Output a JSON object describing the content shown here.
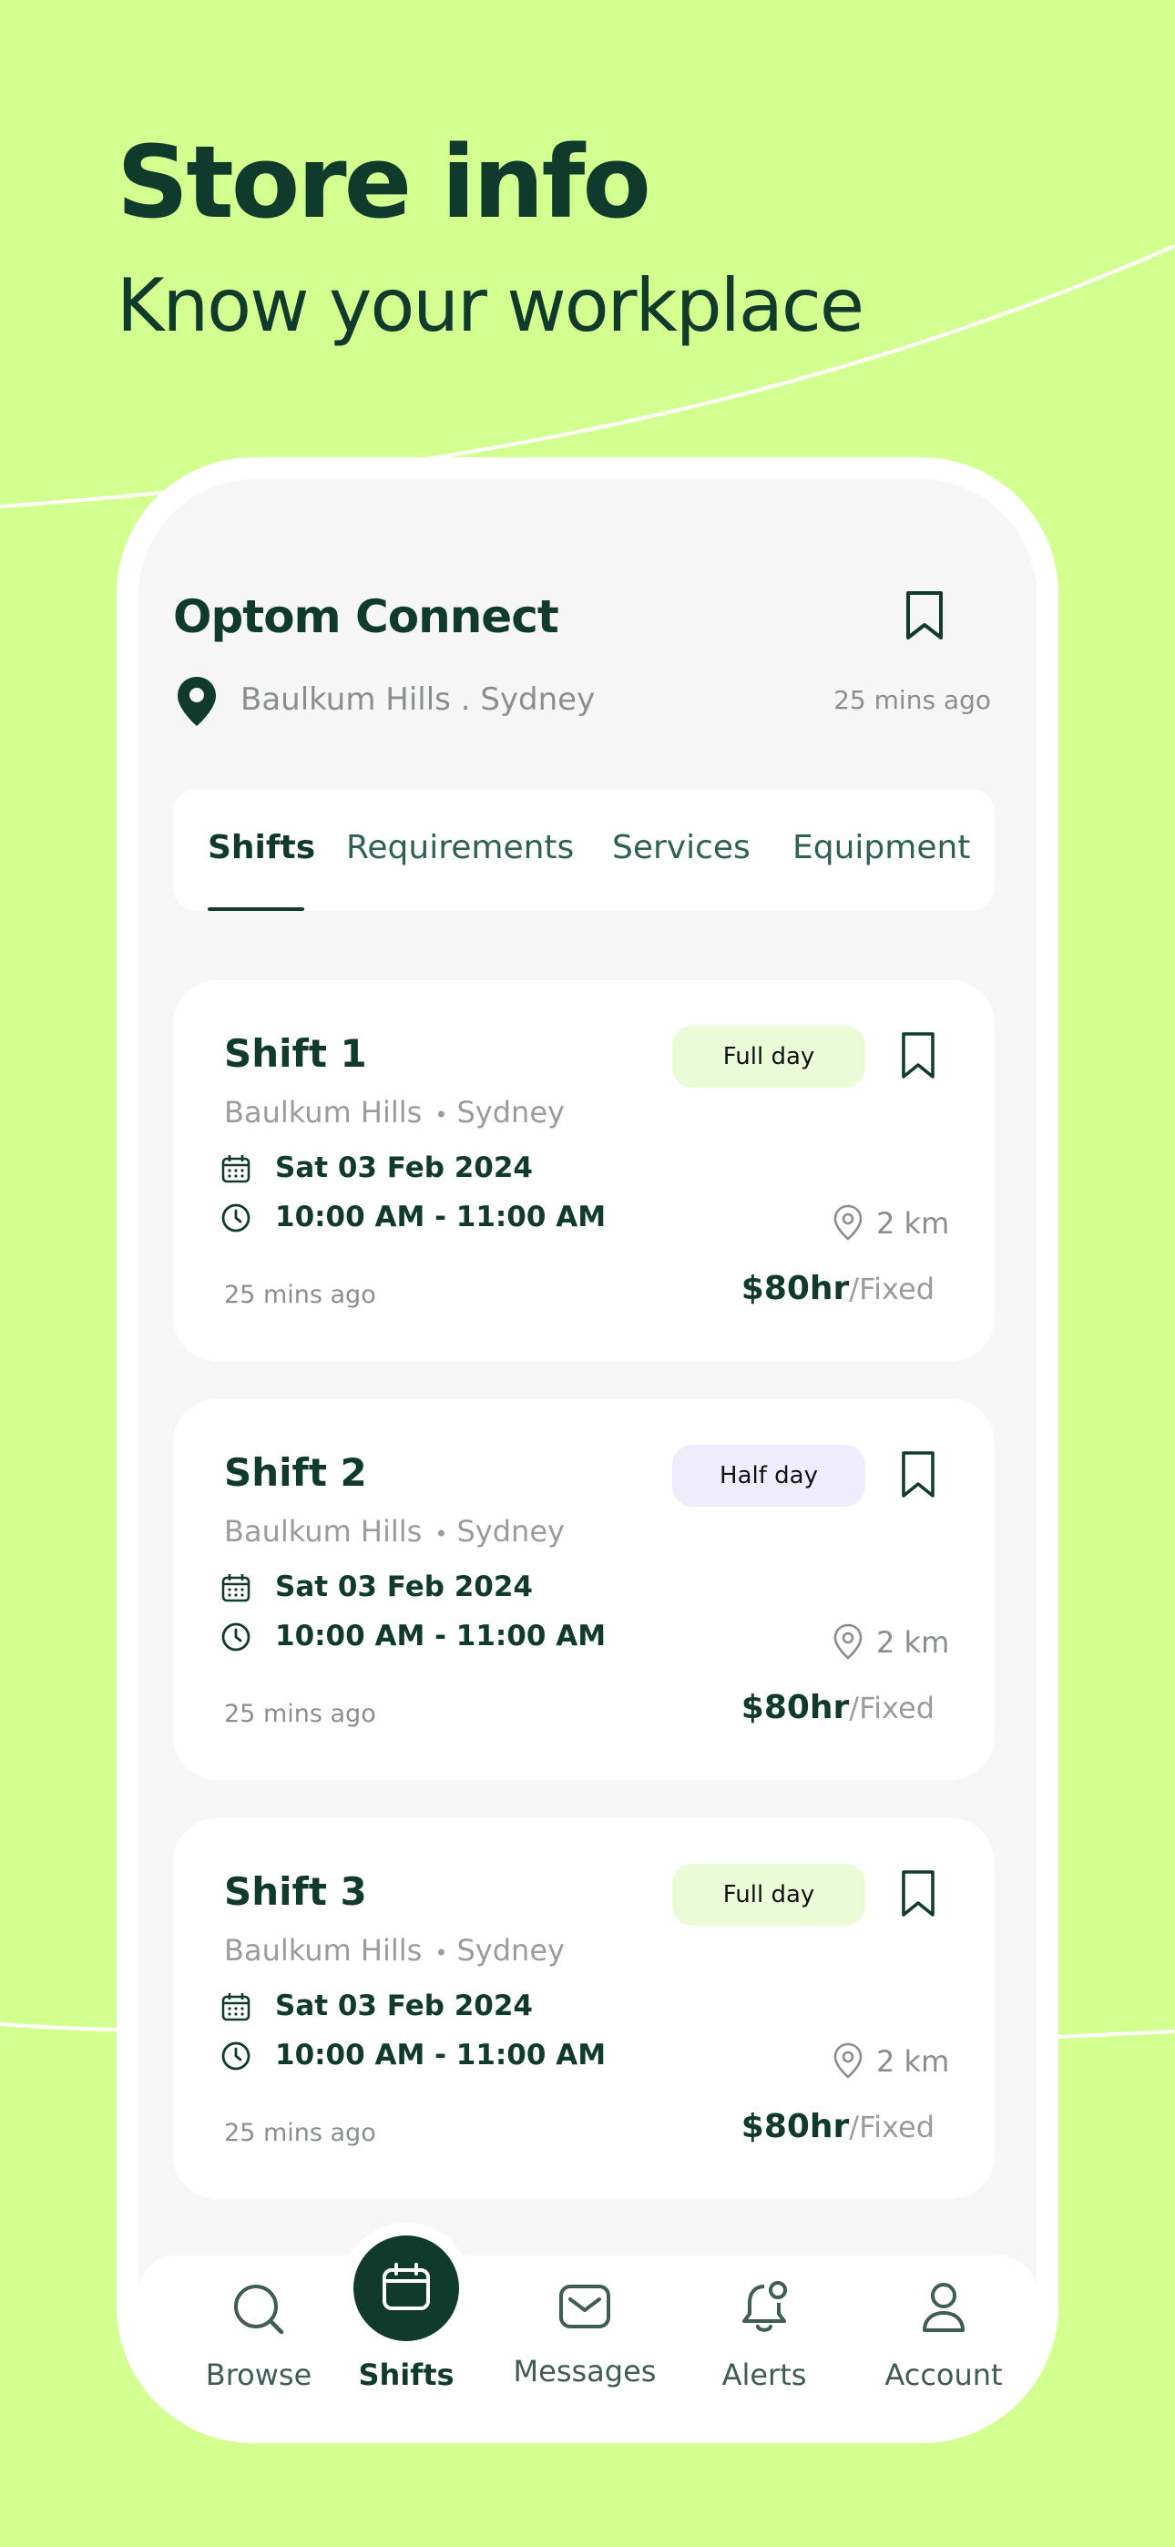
{
  "hero": {
    "title": "Store info",
    "subtitle": "Know your workplace"
  },
  "store": {
    "name": "Optom Connect",
    "location": "Baulkum Hills . Sydney",
    "posted": "25 mins ago"
  },
  "tabs": [
    {
      "label": "Shifts",
      "active": true
    },
    {
      "label": "Requirements",
      "active": false
    },
    {
      "label": "Services",
      "active": false
    },
    {
      "label": "Equipment",
      "active": false
    }
  ],
  "shifts": [
    {
      "title": "Shift 1",
      "badge": "Full day",
      "suburb": "Baulkum Hills",
      "city": "Sydney",
      "date": "Sat 03 Feb 2024",
      "time": "10:00 AM - 11:00 AM",
      "distance": "2 km",
      "posted": "25 mins ago",
      "rate": "$80hr",
      "rate_type": "/Fixed",
      "badge_color": "#ebfbd8"
    },
    {
      "title": "Shift 2",
      "badge": "Half day",
      "suburb": "Baulkum Hills",
      "city": "Sydney",
      "date": "Sat 03 Feb 2024",
      "time": "10:00 AM - 11:00 AM",
      "distance": "2 km",
      "posted": "25 mins ago",
      "rate": "$80hr",
      "rate_type": "/Fixed",
      "badge_color": "#efedfb"
    },
    {
      "title": "Shift 3",
      "badge": "Full day",
      "suburb": "Baulkum Hills",
      "city": "Sydney",
      "date": "Sat 03 Feb 2024",
      "time": "10:00 AM - 11:00 AM",
      "distance": "2 km",
      "posted": "25 mins ago",
      "rate": "$80hr",
      "rate_type": "/Fixed",
      "badge_color": "#ebfbd8"
    }
  ],
  "nav": [
    {
      "label": "Browse",
      "icon": "search-icon",
      "active": false
    },
    {
      "label": "Shifts",
      "icon": "calendar-icon",
      "active": true
    },
    {
      "label": "Messages",
      "icon": "mail-icon",
      "active": false
    },
    {
      "label": "Alerts",
      "icon": "bell-icon",
      "active": false
    },
    {
      "label": "Account",
      "icon": "user-icon",
      "active": false
    }
  ],
  "colors": {
    "background": "#d2ff8f",
    "primary": "#0f3a2c",
    "muted": "#8a8f8c"
  }
}
